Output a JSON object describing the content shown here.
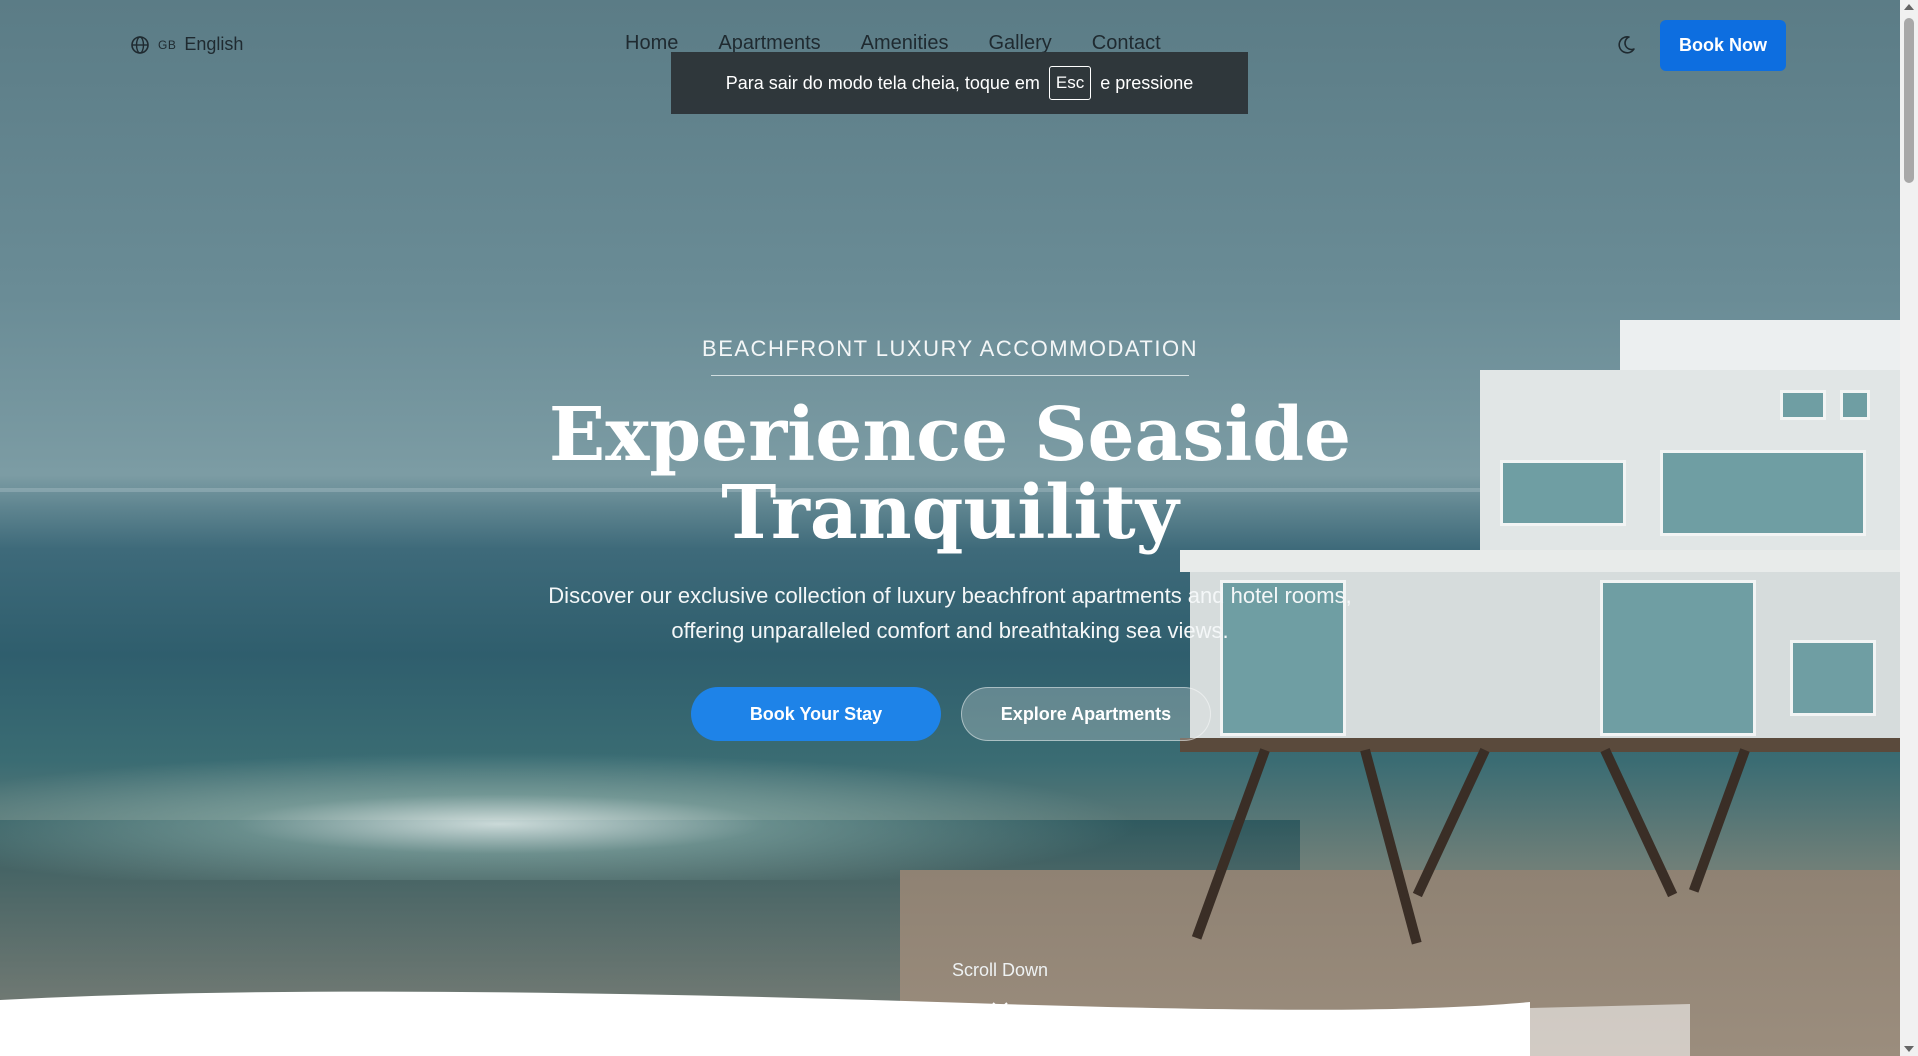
{
  "header": {
    "language_flag": "GB",
    "language": "English",
    "nav": [
      "Home",
      "Apartments",
      "Amenities",
      "Gallery",
      "Contact"
    ],
    "book_now": "Book Now",
    "icons": {
      "language": "globe-icon",
      "theme": "moon-icon"
    }
  },
  "fullscreen_notice": {
    "before": "Para sair do modo tela cheia, toque em",
    "key": "Esc",
    "after": "e pressione"
  },
  "hero": {
    "eyebrow": "BEACHFRONT LUXURY ACCOMMODATION",
    "title_line1": "Experience Seaside",
    "title_line2": "Tranquility",
    "subtitle": "Discover our exclusive collection of luxury beachfront apartments and hotel rooms, offering unparalleled comfort and breathtaking sea views.",
    "primary_button": "Book Your Stay",
    "secondary_button": "Explore Apartments",
    "scroll_label": "Scroll Down"
  },
  "colors": {
    "accent": "#0d6ee0",
    "primary_button": "#1e83e8",
    "toast_bg": "#2d3438"
  }
}
